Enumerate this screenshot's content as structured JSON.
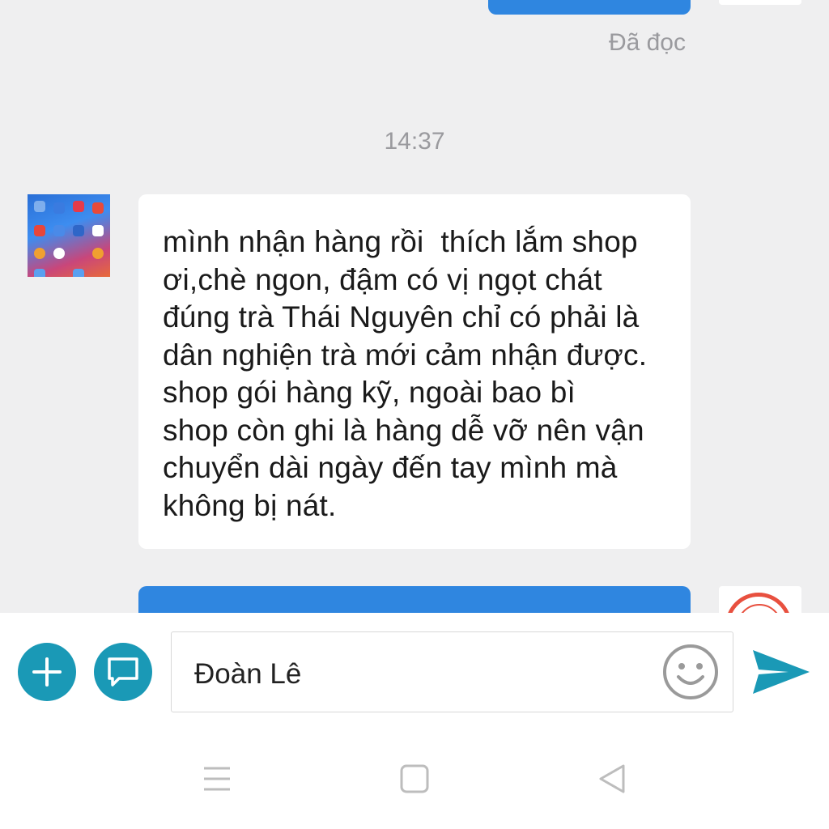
{
  "conversation": {
    "read_status": "Đã đọc",
    "timestamp": "14:37",
    "incoming_message": "mình nhận hàng rồi  thích lắm shop\nơi,chè ngon, đậm có vị ngọt chát\nđúng trà Thái Nguyên chỉ có phải là\ndân nghiện trà mới cảm nhận được.\nshop gói hàng kỹ, ngoài bao bì\nshop còn ghi là hàng dễ vỡ nên vận\nchuyển dài ngày đến tay mình mà\nkhông bị nát."
  },
  "composer": {
    "input_value": "Đoàn Lê",
    "plus_icon": "plus-icon",
    "note_icon": "speech-bubble-icon",
    "emoji_icon": "smiley-icon",
    "send_icon": "send-arrow-icon"
  },
  "navbar": {
    "menu_icon": "menu-icon",
    "home_icon": "square-home-icon",
    "back_icon": "triangle-back-icon"
  },
  "colors": {
    "accent": "#1a99b6",
    "outgoing_bubble": "#2f86e0",
    "background": "#efeff0",
    "seal_red": "#e8503f"
  }
}
